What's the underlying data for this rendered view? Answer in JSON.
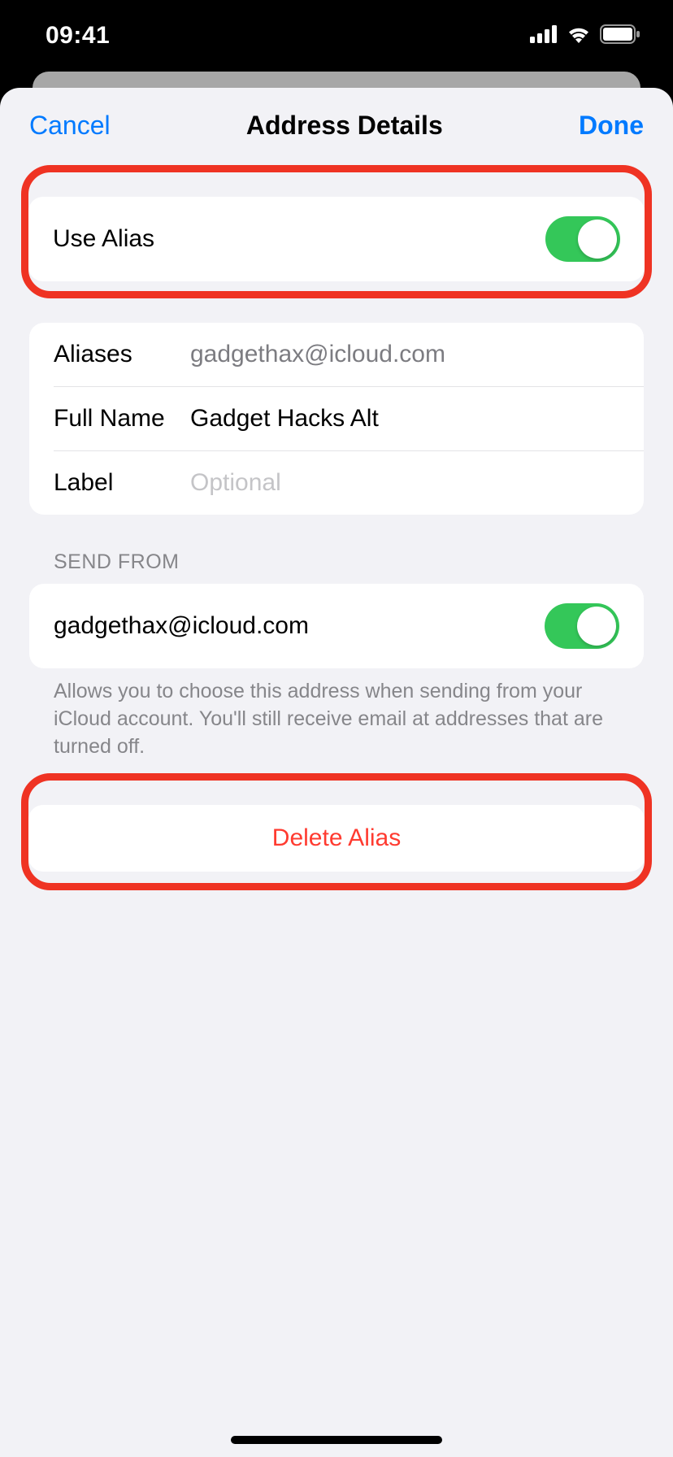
{
  "status": {
    "time": "09:41"
  },
  "nav": {
    "cancel": "Cancel",
    "title": "Address Details",
    "done": "Done"
  },
  "useAlias": {
    "label": "Use Alias",
    "on": true
  },
  "form": {
    "aliasesLabel": "Aliases",
    "aliasesValue": "gadgethax@icloud.com",
    "fullNameLabel": "Full Name",
    "fullNameValue": "Gadget Hacks Alt",
    "labelLabel": "Label",
    "labelPlaceholder": "Optional"
  },
  "sendFrom": {
    "header": "SEND FROM",
    "address": "gadgethax@icloud.com",
    "on": true,
    "footer": "Allows you to choose this address when sending from your iCloud account. You'll still receive email at addresses that are turned off."
  },
  "delete": {
    "label": "Delete Alias"
  }
}
